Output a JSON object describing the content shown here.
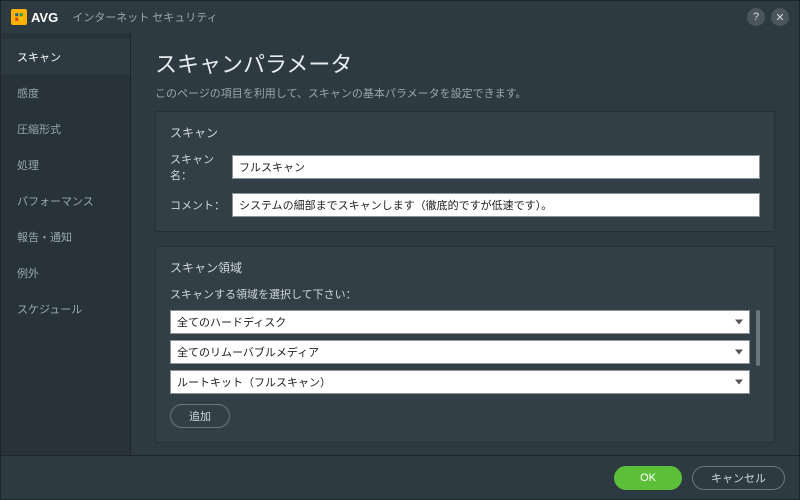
{
  "titlebar": {
    "brand": "AVG",
    "product": "インターネット セキュリティ"
  },
  "sidebar": {
    "items": [
      {
        "label": "スキャン",
        "active": true
      },
      {
        "label": "感度"
      },
      {
        "label": "圧縮形式"
      },
      {
        "label": "処理"
      },
      {
        "label": "パフォーマンス"
      },
      {
        "label": "報告・通知"
      },
      {
        "label": "例外"
      },
      {
        "label": "スケジュール"
      }
    ]
  },
  "page": {
    "title": "スキャンパラメータ",
    "description": "このページの項目を利用して、スキャンの基本パラメータを設定できます。"
  },
  "scan_panel": {
    "title": "スキャン",
    "name_label": "スキャン名：",
    "name_value": "フルスキャン",
    "comment_label": "コメント：",
    "comment_value": "システムの細部までスキャンします（徹底的ですが低速です）。"
  },
  "area_panel": {
    "title": "スキャン領域",
    "desc": "スキャンする領域を選択して下さい：",
    "items": [
      "全てのハードディスク",
      "全てのリムーバブルメディア",
      "ルートキット（フルスキャン）"
    ],
    "add_label": "追加"
  },
  "footer": {
    "ok": "OK",
    "cancel": "キャンセル"
  }
}
